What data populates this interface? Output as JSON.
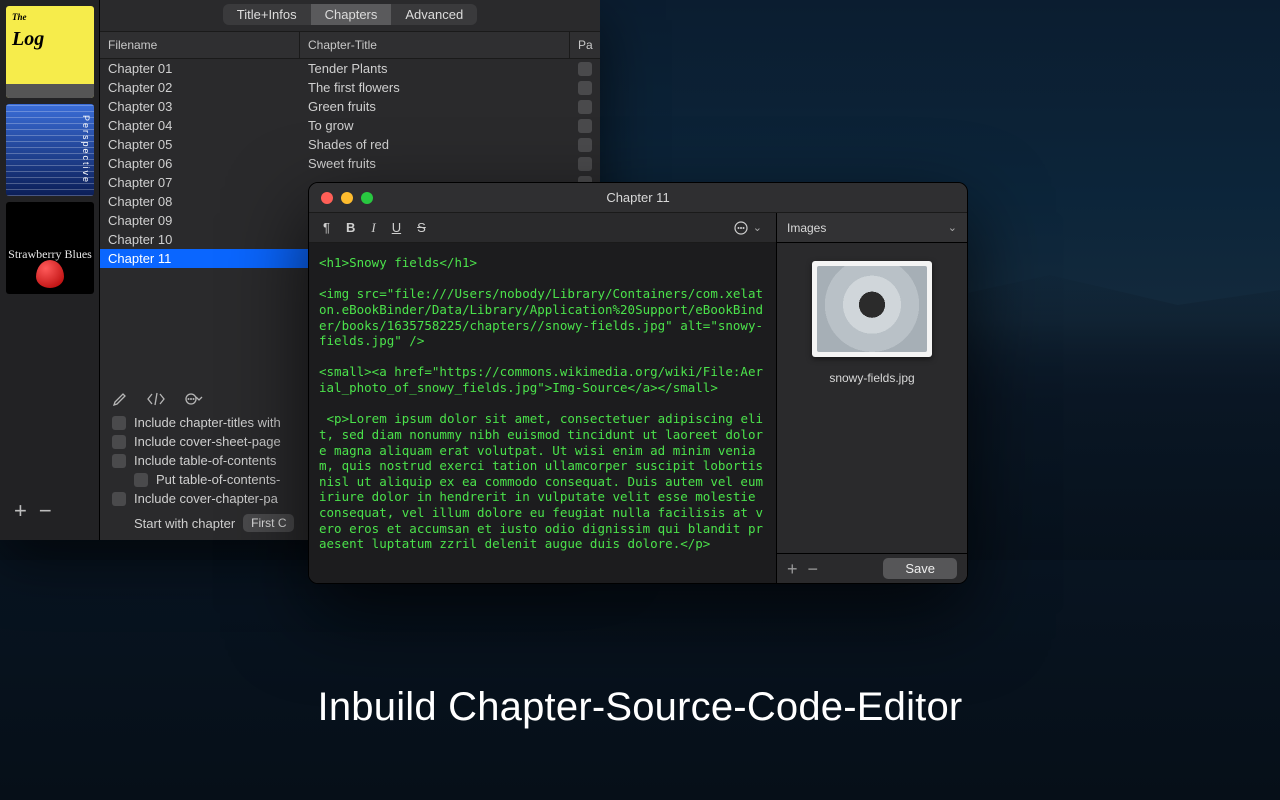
{
  "caption": "Inbuild Chapter-Source-Code-Editor",
  "sidebar": {
    "books": [
      {
        "title": "The",
        "subtitle": "Log"
      },
      {
        "title": "Perspective"
      },
      {
        "title": "Strawberry Blues"
      }
    ],
    "add_icon": "plus-icon",
    "remove_icon": "minus-icon"
  },
  "segments": {
    "items": [
      "Title+Infos",
      "Chapters",
      "Advanced"
    ],
    "active": "Chapters"
  },
  "table": {
    "columns": {
      "filename": "Filename",
      "title": "Chapter-Title",
      "pa": "Pa"
    },
    "rows": [
      {
        "filename": "Chapter 01",
        "title": "Tender Plants"
      },
      {
        "filename": "Chapter 02",
        "title": "The first flowers"
      },
      {
        "filename": "Chapter 03",
        "title": "Green fruits"
      },
      {
        "filename": "Chapter 04",
        "title": "To grow"
      },
      {
        "filename": "Chapter 05",
        "title": "Shades of red"
      },
      {
        "filename": "Chapter 06",
        "title": "Sweet fruits"
      },
      {
        "filename": "Chapter 07",
        "title": ""
      },
      {
        "filename": "Chapter 08",
        "title": ""
      },
      {
        "filename": "Chapter 09",
        "title": ""
      },
      {
        "filename": "Chapter 10",
        "title": ""
      },
      {
        "filename": "Chapter 11",
        "title": ""
      }
    ],
    "selected_index": 10
  },
  "options": {
    "o1": "Include chapter-titles with",
    "o2": "Include cover-sheet-page",
    "o3": "Include table-of-contents",
    "o3a": "Put table-of-contents-",
    "o4": "Include cover-chapter-pa",
    "start_label": "Start with chapter",
    "start_value": "First C"
  },
  "editor": {
    "title": "Chapter 11",
    "images_header": "Images",
    "image_filename": "snowy-fields.jpg",
    "save_label": "Save",
    "code_lines": [
      "<h1>Snowy fields</h1>",
      "",
      "<img src=\"file:///Users/nobody/Library/Containers/com.xelaton.eBookBinder/Data/Library/Application%20Support/eBookBinder/books/1635758225/chapters//snowy-fields.jpg\" alt=\"snowy-fields.jpg\" />",
      "",
      "<small><a href=\"https://commons.wikimedia.org/wiki/File:Aerial_photo_of_snowy_fields.jpg\">Img-Source</a></small>",
      "",
      " <p>Lorem ipsum dolor sit amet, consectetuer adipiscing elit, sed diam nonummy nibh euismod tincidunt ut laoreet dolore magna aliquam erat volutpat. Ut wisi enim ad minim veniam, quis nostrud exerci tation ullamcorper suscipit lobortis nisl ut aliquip ex ea commodo consequat. Duis autem vel eum iriure dolor in hendrerit in vulputate velit esse molestie consequat, vel illum dolore eu feugiat nulla facilisis at vero eros et accumsan et iusto odio dignissim qui blandit praesent luptatum zzril delenit augue duis dolore.</p>"
    ]
  }
}
